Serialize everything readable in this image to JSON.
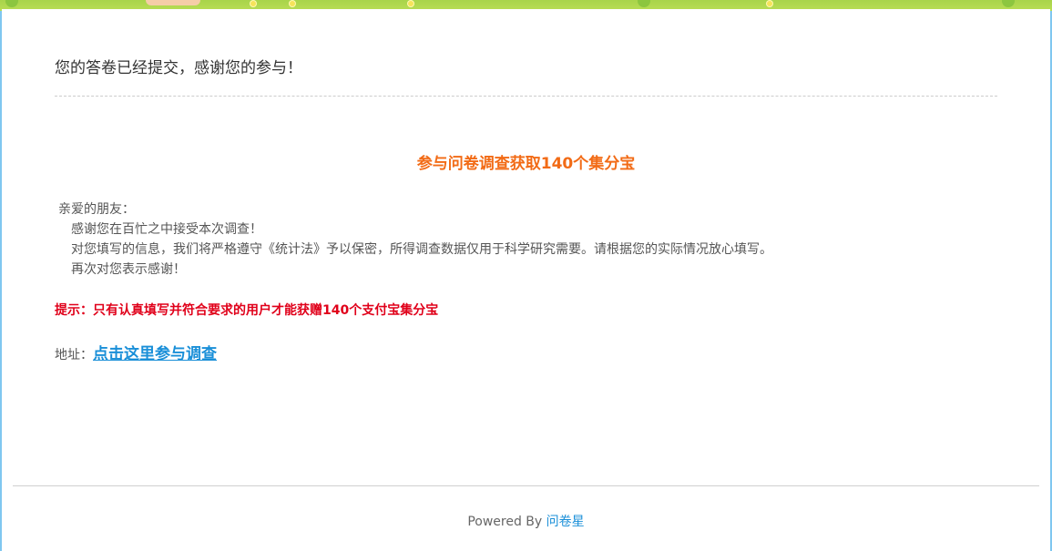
{
  "header": {
    "message": "您的答卷已经提交，感谢您的参与！"
  },
  "promo": {
    "title": "参与问卷调查获取140个集分宝"
  },
  "letter": {
    "greeting": "亲爱的朋友：",
    "lines": [
      "感谢您在百忙之中接受本次调查！",
      "对您填写的信息，我们将严格遵守《统计法》予以保密，所得调查数据仅用于科学研究需要。请根据您的实际情况放心填写。",
      "再次对您表示感谢！"
    ]
  },
  "tip": {
    "text": "提示：只有认真填写并符合要求的用户才能获赠140个支付宝集分宝"
  },
  "address": {
    "label": "地址：",
    "link_text": "点击这里参与调查"
  },
  "footer": {
    "powered_by": "Powered By",
    "brand": "问卷星"
  },
  "colors": {
    "promo_title": "#f26b16",
    "tip": "#e0001a",
    "link": "#1a8fd8",
    "side_background": "#7fc7f0",
    "banner_green": "#a8d44a"
  }
}
